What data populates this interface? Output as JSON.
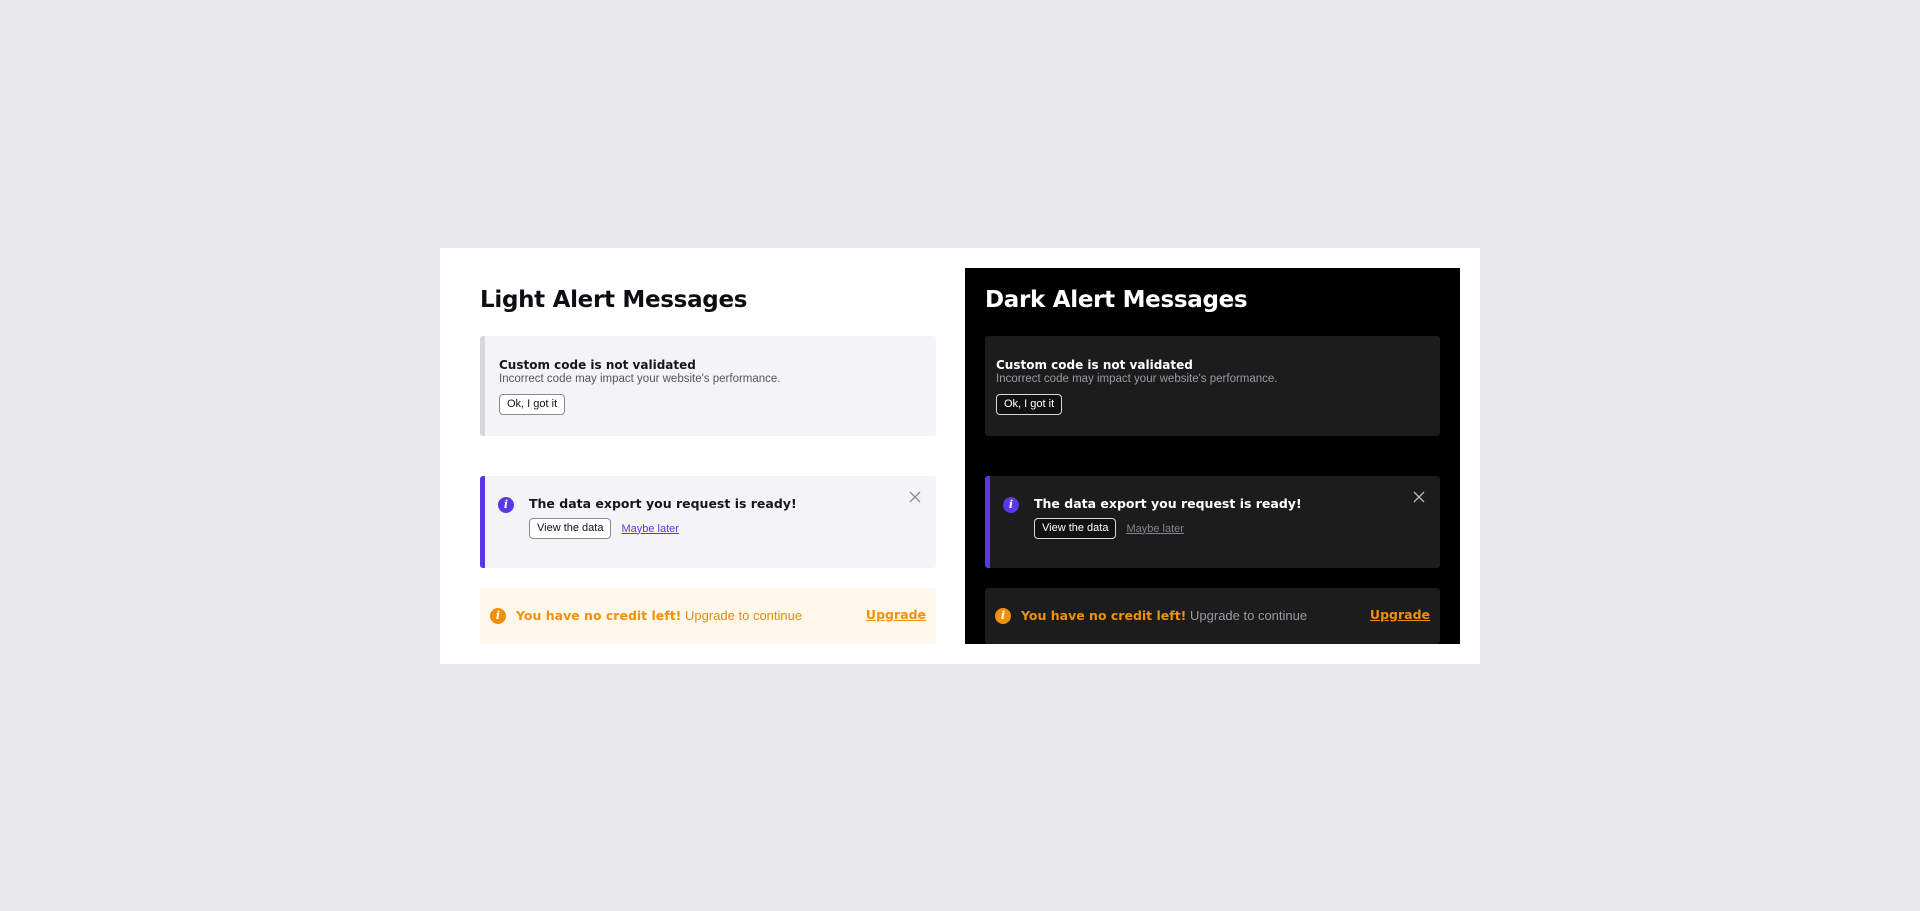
{
  "light": {
    "title": "Light Alert Messages",
    "validate": {
      "title": "Custom code is not validated",
      "description": "Incorrect code may impact your website's performance.",
      "ok_label": "Ok, I got it"
    },
    "export": {
      "icon": "info-icon",
      "title": "The data export you request is ready!",
      "view_label": "View the data",
      "later_label": "Maybe later",
      "close_icon": "close-icon"
    },
    "credit": {
      "icon": "warning-icon",
      "strong": "You have no credit left!",
      "sub": "Upgrade to continue",
      "upgrade_label": "Upgrade"
    }
  },
  "dark": {
    "title": "Dark Alert Messages",
    "validate": {
      "title": "Custom code is not validated",
      "description": "Incorrect code may impact your website's performance.",
      "ok_label": "Ok, I got it"
    },
    "export": {
      "icon": "info-icon",
      "title": "The data export you request is ready!",
      "view_label": "View the data",
      "later_label": "Maybe later",
      "close_icon": "close-icon"
    },
    "credit": {
      "icon": "warning-icon",
      "strong": "You have no credit left!",
      "sub": "Upgrade to continue",
      "upgrade_label": "Upgrade"
    }
  },
  "colors": {
    "accent": "#5b36e6",
    "warning": "#f0900b",
    "page_bg": "#e9e8ed"
  }
}
